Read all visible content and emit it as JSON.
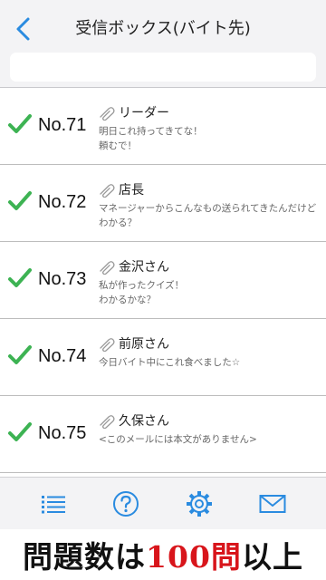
{
  "header": {
    "title": "受信ボックス(バイト先)",
    "search_placeholder": ""
  },
  "messages": [
    {
      "number": "No.71",
      "sender": "リーダー",
      "preview": "明日これ持ってきてな！\n頼むで！",
      "read": true
    },
    {
      "number": "No.72",
      "sender": "店長",
      "preview": "マネージャーからこんなもの送られてきたんだけど\nわかる？",
      "read": true
    },
    {
      "number": "No.73",
      "sender": "金沢さん",
      "preview": "私が作ったクイズ！\nわかるかな？",
      "read": true
    },
    {
      "number": "No.74",
      "sender": "前原さん",
      "preview": "今日バイト中にこれ食べました☆",
      "read": true
    },
    {
      "number": "No.75",
      "sender": "久保さん",
      "preview": "<このメールには本文がありません>",
      "read": true
    }
  ],
  "toolbar": {
    "icons": [
      "list-icon",
      "help-icon",
      "gear-icon",
      "mail-icon"
    ]
  },
  "banner": {
    "part1": "問題数は",
    "part2": "100問",
    "part3": "以上"
  },
  "colors": {
    "accent": "#2a8be0",
    "check": "#3db353",
    "banner_highlight": "#d8151b"
  }
}
